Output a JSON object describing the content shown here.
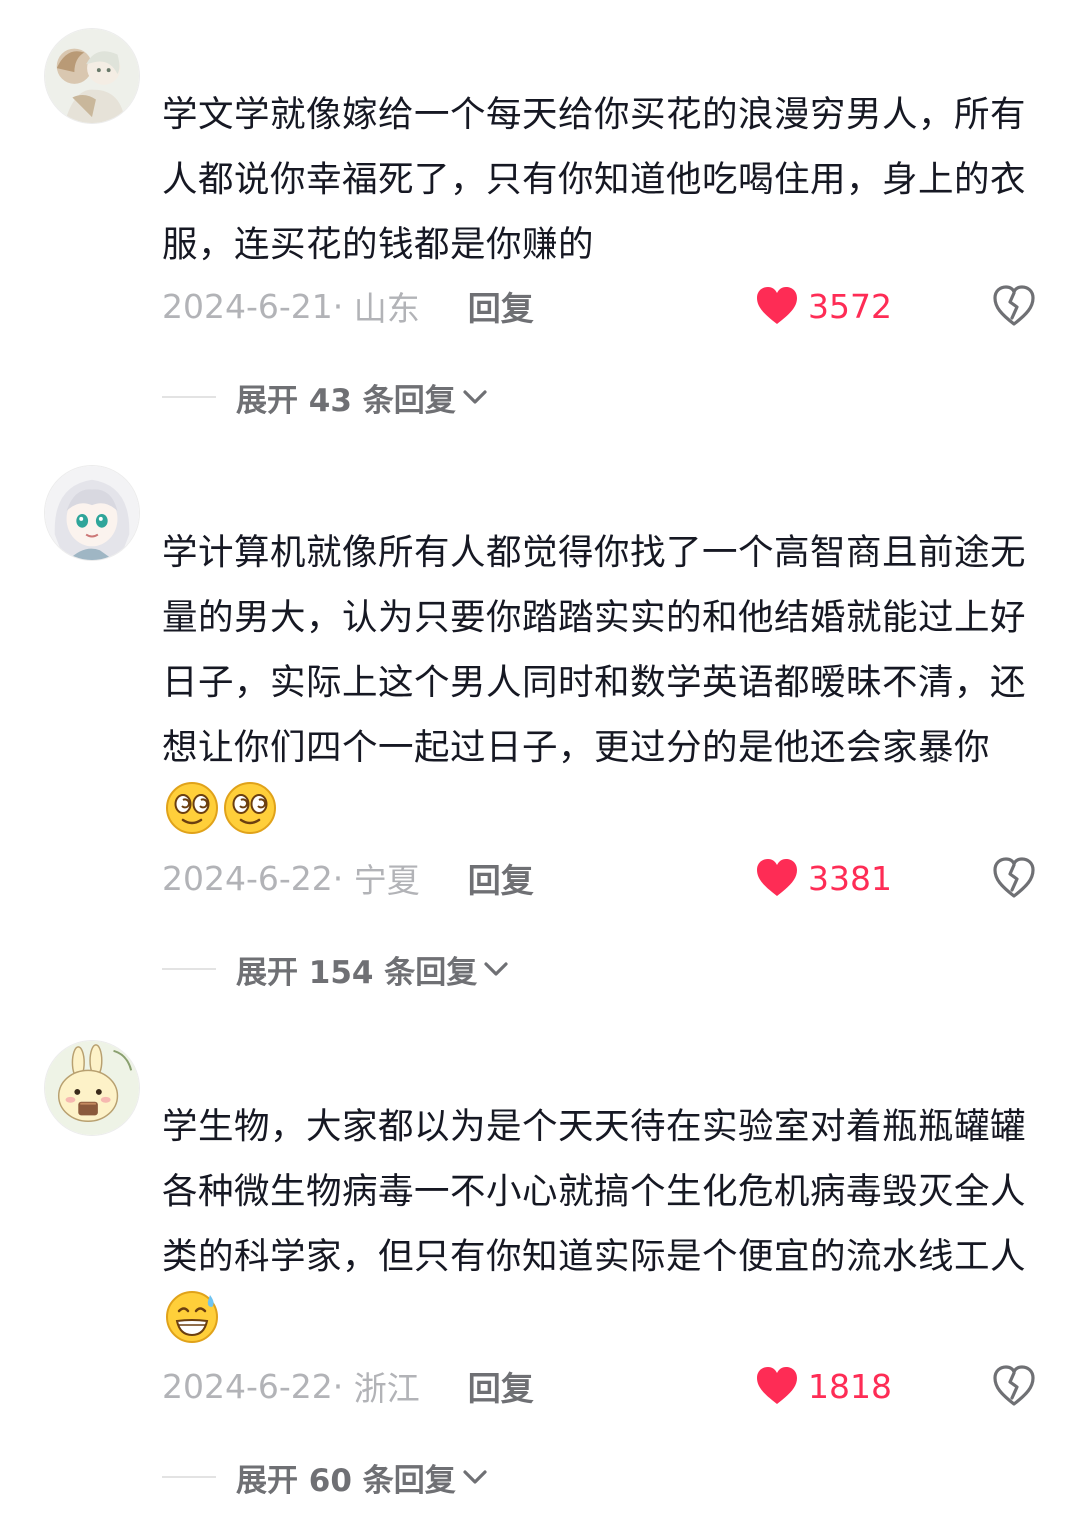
{
  "comments": [
    {
      "text": "学文学就像嫁给一个每天给你买花的浪漫穷男人，所有人都说你幸福死了，只有你知道他吃喝住用，身上的衣服，连买花的钱都是你赚的",
      "date": "2024-6-21",
      "location": "山东",
      "reply_label": "回复",
      "likes": "3572",
      "expand_label": "展开 43 条回复",
      "avatar_icon": "anime-girl-avatar",
      "emoji_icons": []
    },
    {
      "text": "学计算机就像所有人都觉得你找了一个高智商且前途无量的男大，认为只要你踏踏实实的和他结婚就能过上好日子，实际上这个男人同时和数学英语都暧昧不清，还想让你们四个一起过日子，更过分的是他还会家暴你",
      "date": "2024-6-22",
      "location": "宁夏",
      "reply_label": "回复",
      "likes": "3381",
      "expand_label": "展开 154 条回复",
      "avatar_icon": "anime-girl-green-eyes-avatar",
      "emoji_icons": [
        "dizzy-face-emoji",
        "dizzy-face-emoji"
      ]
    },
    {
      "text": "学生物，大家都以为是个天天待在实验室对着瓶瓶罐罐各种微生物病毒一不小心就搞个生化危机病毒毁灭全人类的科学家，但只有你知道实际是个便宜的流水线工人",
      "date": "2024-6-22",
      "location": "浙江",
      "reply_label": "回复",
      "likes": "1818",
      "expand_label": "展开 60 条回复",
      "avatar_icon": "cartoon-rabbit-avatar",
      "emoji_icons": [
        "grin-sweat-emoji"
      ]
    }
  ],
  "colors": {
    "like": "#fe2c55",
    "text": "#161823",
    "meta": "#b2b3b7",
    "action": "#6f7074"
  }
}
